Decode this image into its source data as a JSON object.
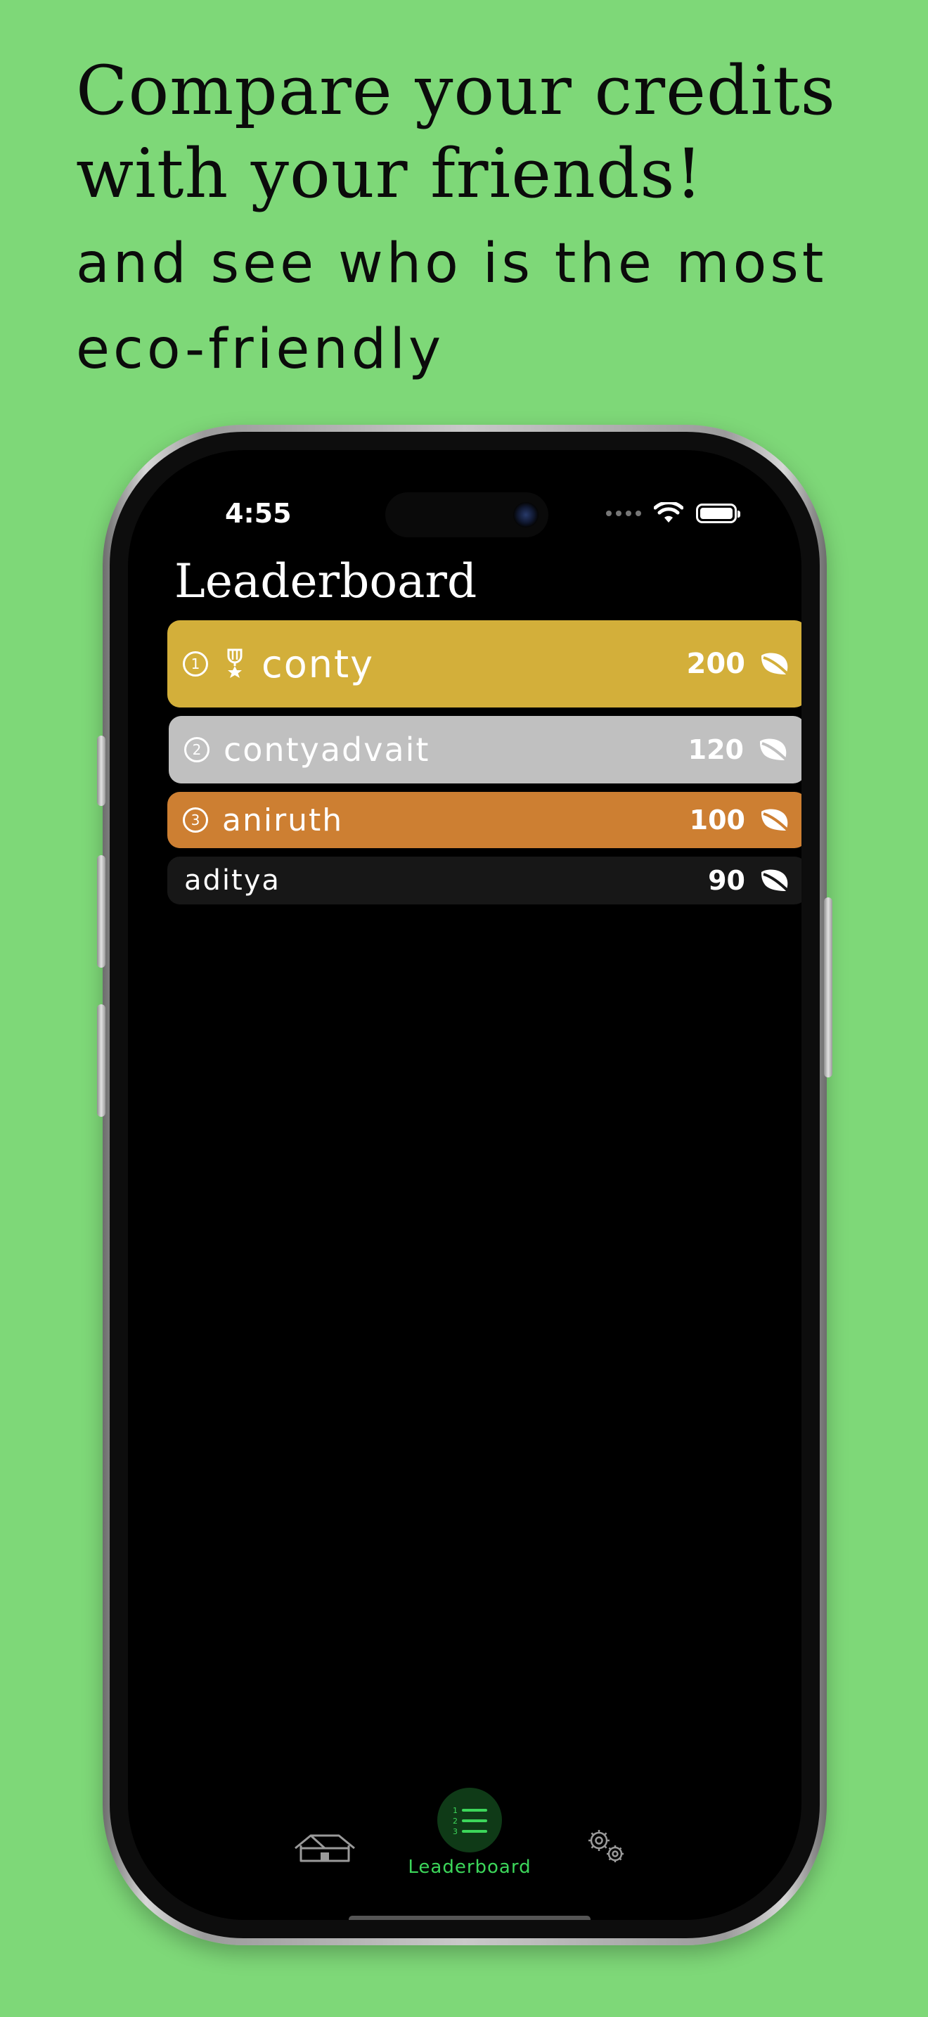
{
  "promo": {
    "headline": "Compare your credits with your friends!",
    "subheadline": "and see who is the most eco-friendly"
  },
  "status_bar": {
    "time": "4:55"
  },
  "leaderboard": {
    "title": "Leaderboard",
    "entries": [
      {
        "rank": "1",
        "name": "conty",
        "score": "200",
        "color": "#d3af3a",
        "trophy_icon": "trophy-icon",
        "score_icon": "leaf-icon"
      },
      {
        "rank": "2",
        "name": "contyadvait",
        "score": "120",
        "color": "#c0c0c0",
        "score_icon": "leaf-icon"
      },
      {
        "rank": "3",
        "name": "aniruth",
        "score": "100",
        "color": "#cd7f32",
        "score_icon": "leaf-icon"
      },
      {
        "name": "aditya",
        "score": "90",
        "color": "#171717",
        "score_icon": "leaf-icon"
      }
    ]
  },
  "tab_bar": {
    "items": [
      {
        "id": "home",
        "icon": "house-icon"
      },
      {
        "id": "leaderboard",
        "icon": "numbered-list-icon",
        "label": "Leaderboard",
        "selected": true
      },
      {
        "id": "settings",
        "icon": "gears-icon"
      }
    ],
    "accent_color": "#3cd65a",
    "selected_bg": "#0f3a17"
  },
  "background_color": "#7ed878"
}
